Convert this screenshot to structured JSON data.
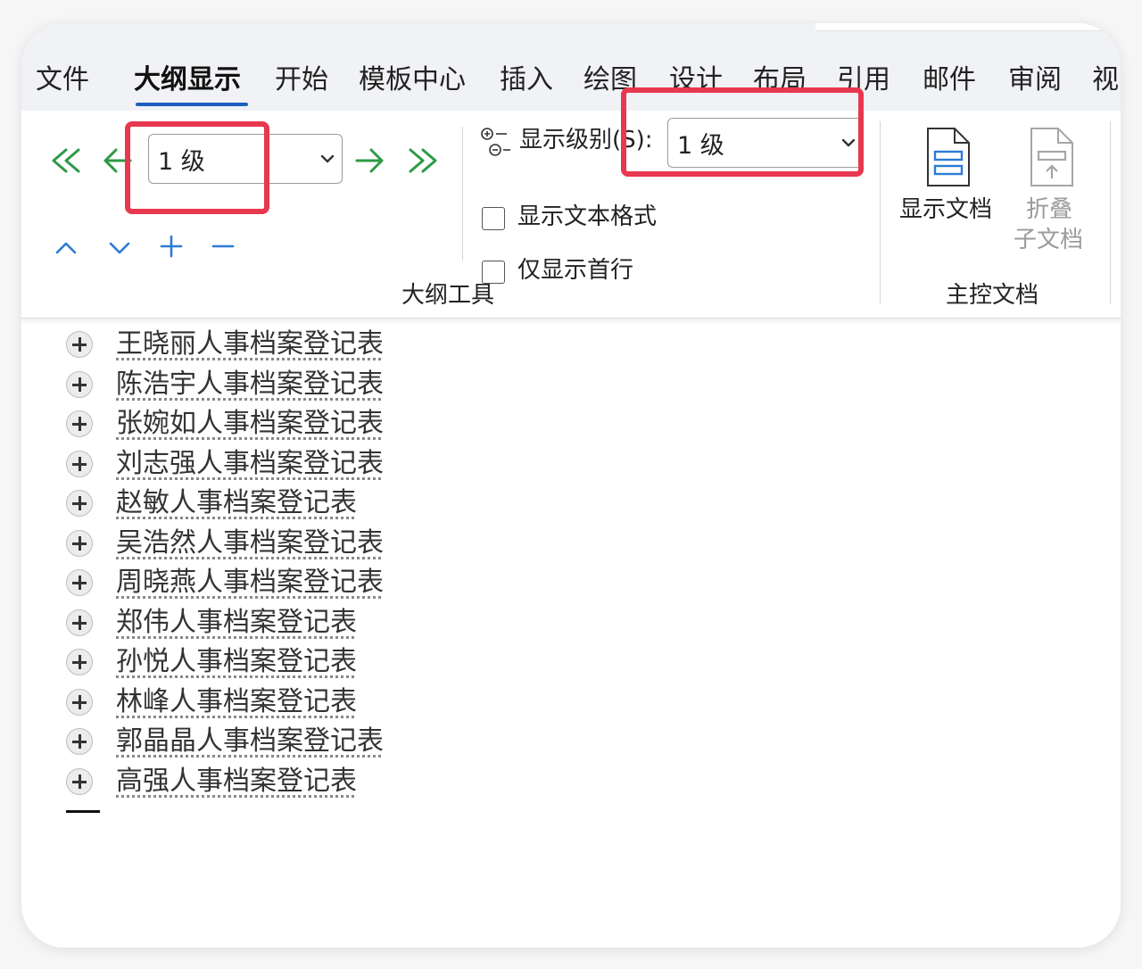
{
  "tabs": [
    {
      "label": "文件"
    },
    {
      "label": "大纲显示",
      "active": true
    },
    {
      "label": "开始"
    },
    {
      "label": "模板中心"
    },
    {
      "label": "插入"
    },
    {
      "label": "绘图"
    },
    {
      "label": "设计"
    },
    {
      "label": "布局"
    },
    {
      "label": "引用"
    },
    {
      "label": "邮件"
    },
    {
      "label": "审阅"
    },
    {
      "label": "视"
    }
  ],
  "ribbon": {
    "level_combo_value": "1 级",
    "show_level_label": "显示级别(S):",
    "show_level_value": "1 级",
    "show_text_format_label": "显示文本格式",
    "show_first_line_label": "仅显示首行",
    "outline_tools_label": "大纲工具",
    "show_document_label": "显示文档",
    "collapse_subdoc_label_1": "折叠",
    "collapse_subdoc_label_2": "子文档",
    "master_document_label": "主控文档"
  },
  "colors": {
    "accent_green": "#2d9a46",
    "accent_blue": "#2b7bd6",
    "highlight_red": "#e8384f",
    "tab_underline": "#1f5fbf"
  },
  "outline_items": [
    "王晓丽人事档案登记表",
    "陈浩宇人事档案登记表",
    "张婉如人事档案登记表",
    "刘志强人事档案登记表",
    "赵敏人事档案登记表",
    "吴浩然人事档案登记表",
    "周晓燕人事档案登记表",
    "郑伟人事档案登记表",
    "孙悦人事档案登记表",
    "林峰人事档案登记表",
    "郭晶晶人事档案登记表",
    "高强人事档案登记表"
  ]
}
